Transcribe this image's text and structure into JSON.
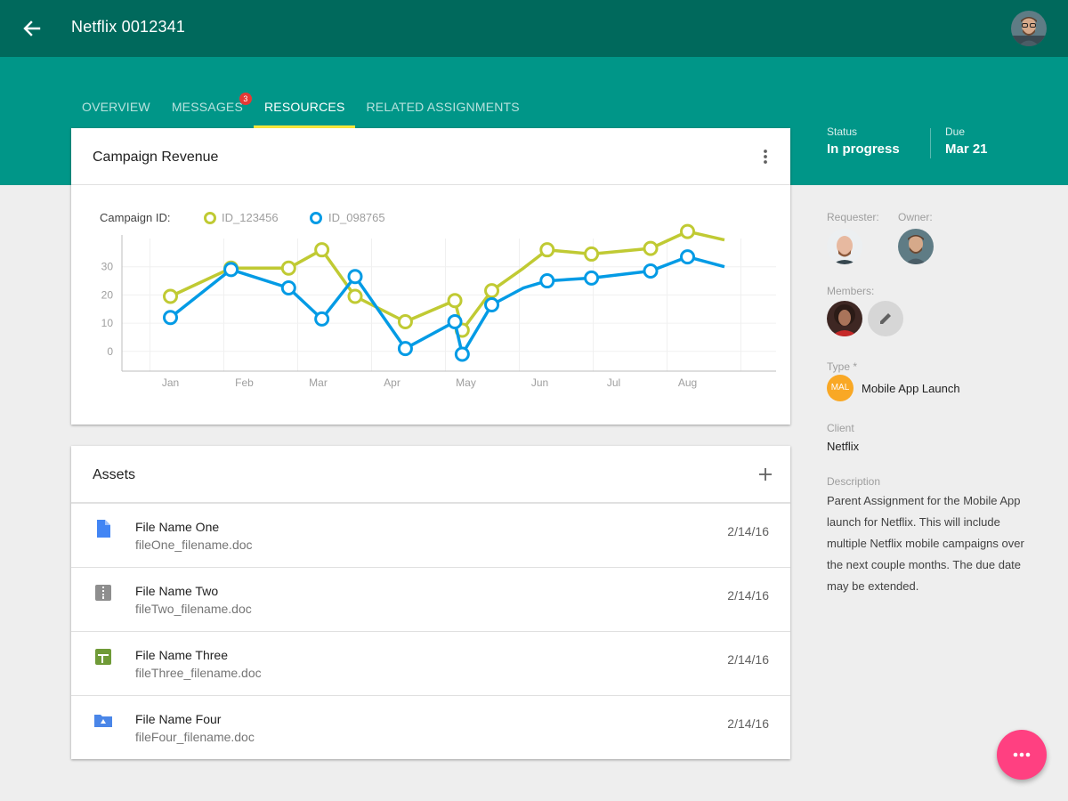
{
  "header": {
    "title": "Netflix 0012341",
    "back_icon": "arrow-back-icon",
    "avatar": "user-avatar"
  },
  "tabs": [
    {
      "label": "OVERVIEW",
      "active": false
    },
    {
      "label": "MESSAGES",
      "active": false,
      "badge": "3"
    },
    {
      "label": "RESOURCES",
      "active": true
    },
    {
      "label": "RELATED ASSIGNMENTS",
      "active": false
    }
  ],
  "meta": {
    "status_label": "Status",
    "status_value": "In progress",
    "due_label": "Due",
    "due_value": "Mar 21"
  },
  "chart_card": {
    "title": "Campaign Revenue",
    "menu_icon": "more-vert-icon"
  },
  "chart_data": {
    "type": "line",
    "legend_label": "Campaign ID:",
    "legend_position": "top-left",
    "categories": [
      "Jan",
      "Feb",
      "Mar",
      "Apr",
      "May",
      "Jun",
      "Jul",
      "Aug"
    ],
    "y_ticks": [
      "30",
      "20",
      "10",
      "0"
    ],
    "ylim": [
      -7,
      40
    ],
    "grid": true,
    "series": [
      {
        "name": "ID_123456",
        "color": "#c0ca33",
        "x": [
          0.5,
          1.32,
          2.1,
          2.55,
          3.0,
          3.68,
          4.35,
          4.45,
          4.85,
          5.28,
          5.6,
          6.2,
          7.0,
          7.5,
          8.0
        ],
        "values": [
          19.5,
          29.5,
          29.5,
          36,
          19.5,
          10.5,
          18,
          7.5,
          21.5,
          29.5,
          36,
          34.5,
          36.5,
          42.5,
          39.5
        ],
        "markers": [
          true,
          true,
          true,
          true,
          true,
          true,
          true,
          true,
          true,
          false,
          true,
          true,
          true,
          true,
          false
        ]
      },
      {
        "name": "ID_098765",
        "color": "#039be5",
        "x": [
          0.5,
          1.32,
          2.1,
          2.55,
          3.0,
          3.68,
          4.35,
          4.45,
          4.85,
          5.28,
          5.6,
          6.2,
          7.0,
          7.5,
          8.0
        ],
        "values": [
          12,
          29,
          22.5,
          11.5,
          26.5,
          1,
          10.5,
          -1,
          16.5,
          22.5,
          25,
          26,
          28.5,
          33.5,
          30
        ],
        "markers": [
          true,
          true,
          true,
          true,
          true,
          true,
          true,
          true,
          true,
          false,
          true,
          true,
          true,
          true,
          false
        ]
      }
    ]
  },
  "assets": {
    "title": "Assets",
    "add_icon": "add-icon",
    "items": [
      {
        "name": "File Name One",
        "file": "fileOne_filename.doc",
        "date": "2/14/16",
        "icon": "doc-icon",
        "color": "#4285f4"
      },
      {
        "name": "File Name Two",
        "file": "fileTwo_filename.doc",
        "date": "2/14/16",
        "icon": "zip-icon",
        "color": "#8e8e8e"
      },
      {
        "name": "File Name Three",
        "file": "fileThree_filename.doc",
        "date": "2/14/16",
        "icon": "sheet-icon",
        "color": "#6f9a37"
      },
      {
        "name": "File Name Four",
        "file": "fileFour_filename.doc",
        "date": "2/14/16",
        "icon": "drive-folder-icon",
        "color": "#4a86e8"
      }
    ]
  },
  "sidebar": {
    "requester_label": "Requester:",
    "owner_label": "Owner:",
    "members_label": "Members:",
    "edit_icon": "edit-icon",
    "type_label": "Type *",
    "type_chip": "MAL",
    "type_value": "Mobile App Launch",
    "client_label": "Client",
    "client_value": "Netflix",
    "description_label": "Description",
    "description_lines": [
      "Parent Assignment for the Mobile App",
      "launch for Netflix. This will include",
      "multiple Netflix mobile campaigns over",
      "the next couple months. The due date",
      "may be extended."
    ]
  },
  "fab": {
    "icon": "more-horiz-icon"
  }
}
